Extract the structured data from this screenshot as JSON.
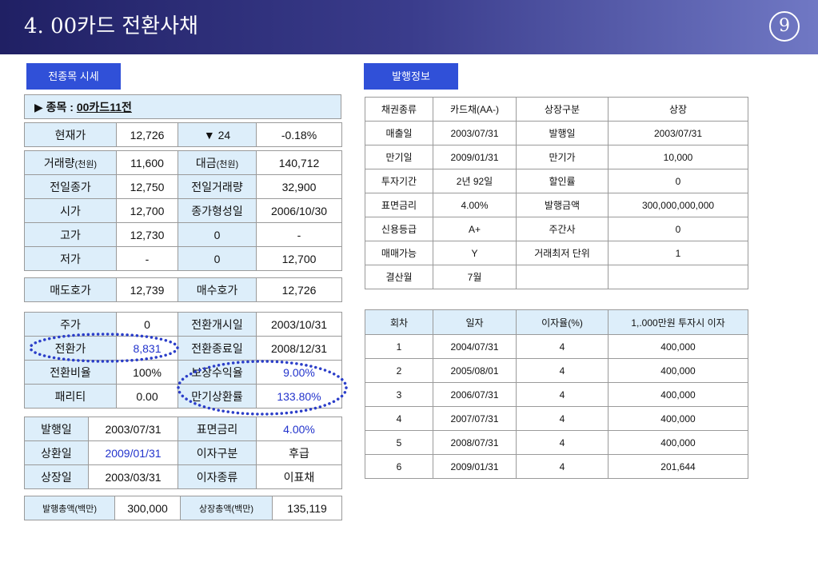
{
  "header": {
    "title": "4. 00카드 전환사채",
    "slide_number": "9"
  },
  "section_labels": {
    "market": "전종목 시세",
    "issue": "발행정보"
  },
  "market": {
    "item": {
      "prefix": "▶ 종목 : ",
      "name": "00카드11전"
    },
    "current": {
      "label": "현재가",
      "price": "12,726",
      "change": "▼ 24",
      "change_rate": "-0.18%"
    },
    "trade": [
      {
        "label": "거래량",
        "label_unit": "(천원)",
        "value": "11,600",
        "label2": "대금",
        "label2_unit": "(천원)",
        "value2": "140,712"
      },
      {
        "label": "전일종가",
        "value": "12,750",
        "label2": "전일거래량",
        "value2": "32,900"
      },
      {
        "label": "시가",
        "value": "12,700",
        "label2": "종가형성일",
        "value2": "2006/10/30"
      },
      {
        "label": "고가",
        "value": "12,730",
        "label2": "0",
        "value2": "-"
      },
      {
        "label": "저가",
        "value": "-",
        "label2": "0",
        "value2": "12,700"
      }
    ],
    "quote": {
      "ask_label": "매도호가",
      "ask": "12,739",
      "bid_label": "매수호가",
      "bid": "12,726"
    },
    "conversion": [
      {
        "label": "주가",
        "value": "0",
        "label2": "전환개시일",
        "value2": "2003/10/31"
      },
      {
        "label": "전환가",
        "value": "8,831",
        "label2": "전환종료일",
        "value2": "2008/12/31"
      },
      {
        "label": "전환비율",
        "value": "100%",
        "label2": "보장수익율",
        "value2": "9.00%"
      },
      {
        "label": "패리티",
        "value": "0.00",
        "label2": "만기상환률",
        "value2": "133.80%"
      }
    ],
    "bond": [
      {
        "label": "발행일",
        "value": "2003/07/31",
        "label2": "표면금리",
        "value2": "4.00%"
      },
      {
        "label": "상환일",
        "value": "2009/01/31",
        "label2": "이자구분",
        "value2": "후급"
      },
      {
        "label": "상장일",
        "value": "2003/03/31",
        "label2": "이자종류",
        "value2": "이표채"
      }
    ],
    "totals": {
      "issued_label": "발행총액(백만)",
      "issued": "300,000",
      "listed_label": "상장총액(백만)",
      "listed": "135,119"
    }
  },
  "issue_info": [
    [
      "채권종류",
      "카드채(AA-)",
      "상장구분",
      "상장"
    ],
    [
      "매출일",
      "2003/07/31",
      "발행일",
      "2003/07/31"
    ],
    [
      "만기일",
      "2009/01/31",
      "만기가",
      "10,000"
    ],
    [
      "투자기간",
      "2년 92일",
      "할인률",
      "0"
    ],
    [
      "표면금리",
      "4.00%",
      "발행금액",
      "300,000,000,000"
    ],
    [
      "신용등급",
      "A+",
      "주간사",
      "0"
    ],
    [
      "매매가능",
      "Y",
      "거래최저 단위",
      "1"
    ],
    [
      "결산월",
      "7월"
    ]
  ],
  "interest_schedule": {
    "headers": [
      "회차",
      "일자",
      "이자율(%)",
      "1,.000만원 투자시 이자"
    ],
    "rows": [
      [
        "1",
        "2004/07/31",
        "4",
        "400,000"
      ],
      [
        "2",
        "2005/08/01",
        "4",
        "400,000"
      ],
      [
        "3",
        "2006/07/31",
        "4",
        "400,000"
      ],
      [
        "4",
        "2007/07/31",
        "4",
        "400,000"
      ],
      [
        "5",
        "2008/07/31",
        "4",
        "400,000"
      ],
      [
        "6",
        "2009/01/31",
        "4",
        "201,644"
      ]
    ]
  },
  "colors": {
    "header_start": "#202064",
    "header_end": "#7078c4",
    "label_box": "#3050d8",
    "label_cell": "#ddeefa",
    "highlight_text": "#2233cc",
    "ellipse": "#2b3ec9"
  }
}
